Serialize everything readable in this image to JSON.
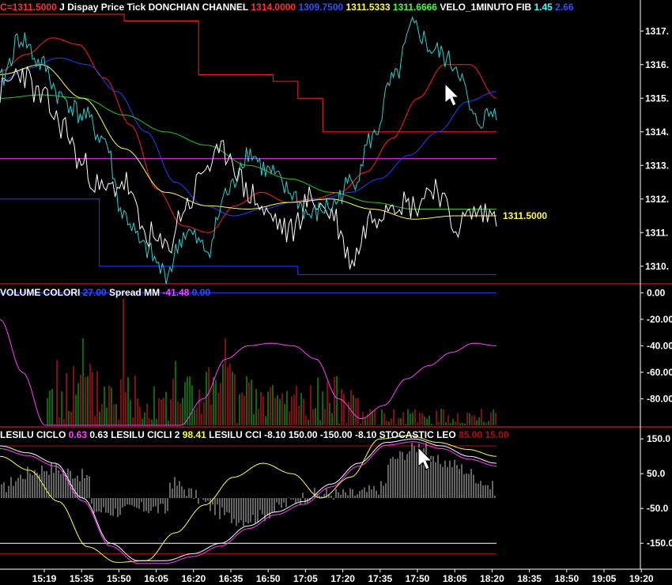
{
  "colors": {
    "bg": "#000000",
    "price": "#ffffff",
    "cyan": "#33cccc",
    "red": "#ff2020",
    "blue": "#2040ff",
    "green": "#20cc20",
    "yellow": "#ffff40",
    "magenta": "#ff40ff",
    "darkred": "#b01010"
  },
  "panels": {
    "price": {
      "header": [
        {
          "text": "C=1311.5000",
          "color": "#ff3030"
        },
        {
          "text": "J Dispay Price Tick",
          "color": "#ffffff"
        },
        {
          "text": "DONCHIAN CHANNEL",
          "color": "#ffffff"
        },
        {
          "text": "1314.0000",
          "color": "#ff3030"
        },
        {
          "text": "1309.7500",
          "color": "#3050ff"
        },
        {
          "text": "1311.5333",
          "color": "#ffff40"
        },
        {
          "text": "1311.6666",
          "color": "#40ff40"
        },
        {
          "text": "VELO_1MINUTO FIB",
          "color": "#ffffff"
        },
        {
          "text": "1.45",
          "color": "#40ffff"
        },
        {
          "text": "2.66",
          "color": "#3050ff"
        }
      ],
      "ticks": [
        "1317.",
        "1316.",
        "1315.",
        "1314.",
        "1313.",
        "1312.",
        "1311.",
        "1310."
      ],
      "last_value_label": "1311.5000"
    },
    "volume": {
      "header": [
        {
          "text": "VOLUME COLORI",
          "color": "#ffffff"
        },
        {
          "text": "27.00",
          "color": "#3050ff"
        },
        {
          "text": "Spread MM",
          "color": "#ffffff"
        },
        {
          "text": "-41.48",
          "color": "#ff40ff"
        },
        {
          "text": "0.00",
          "color": "#3050ff"
        }
      ],
      "ticks": [
        "0.00",
        "-20.00",
        "-40.00",
        "-60.00",
        "-80.00"
      ]
    },
    "osc": {
      "header": [
        {
          "text": "LESILU CICLO",
          "color": "#ffffff"
        },
        {
          "text": "0.63",
          "color": "#ff40ff"
        },
        {
          "text": "0.63",
          "color": "#ffffff"
        },
        {
          "text": "LESILU CICLI 2",
          "color": "#ffffff"
        },
        {
          "text": "98.41",
          "color": "#ffff40"
        },
        {
          "text": "LESILU CCI",
          "color": "#ffffff"
        },
        {
          "text": "-8.10",
          "color": "#ffffff"
        },
        {
          "text": "150.00",
          "color": "#ffffff"
        },
        {
          "text": "-150.00",
          "color": "#ffffff"
        },
        {
          "text": "-8.10",
          "color": "#ffffff"
        },
        {
          "text": "STOCASTIC LEO",
          "color": "#ffffff"
        },
        {
          "text": "85.00",
          "color": "#b01010"
        },
        {
          "text": "15.00",
          "color": "#b01010"
        }
      ],
      "ticks": [
        "150.0",
        "50.0",
        "-50.0",
        "-150.0"
      ]
    }
  },
  "time_axis": [
    "15:19",
    "15:35",
    "15:50",
    "16:05",
    "16:20",
    "16:35",
    "16:50",
    "17:05",
    "17:20",
    "17:35",
    "17:50",
    "18:05",
    "18:20",
    "18:35",
    "18:50",
    "19:05",
    "19:20"
  ],
  "chart_data": {
    "type": "line",
    "price_series": {
      "ylim": [
        1309.5,
        1317.5
      ],
      "donchian_upper": [
        1317.5,
        1317.5,
        1317.5,
        1317.5,
        1317.5,
        1317.3,
        1317.3,
        1317.3,
        1315.7,
        1315.7,
        1315.7,
        1315.5,
        1315.0,
        1314.0,
        1314.0,
        1314.0,
        1314.0,
        1314.0,
        1314.0,
        1314.0
      ],
      "donchian_lower": [
        1312.0,
        1312.0,
        1312.0,
        1312.0,
        1310.0,
        1310.0,
        1310.0,
        1310.0,
        1310.0,
        1310.0,
        1310.0,
        1310.0,
        1309.75,
        1309.75,
        1309.75,
        1309.75,
        1309.75,
        1309.75,
        1309.75,
        1309.75
      ],
      "horizontal_level": 1313.2,
      "close_cyan": [
        1315.5,
        1316.8,
        1316.0,
        1315.0,
        1314.5,
        1313.8,
        1311.5,
        1310.5,
        1309.8,
        1311.0,
        1310.5,
        1312.2,
        1313.4,
        1312.8,
        1312.2,
        1311.5,
        1311.8,
        1312.5,
        1313.8,
        1315.5,
        1317.1,
        1316.4,
        1316.0,
        1314.3,
        1314.6
      ],
      "white_series": [
        1315.2,
        1315.8,
        1315.0,
        1314.2,
        1313.0,
        1312.2,
        1312.5,
        1311.0,
        1310.5,
        1311.8,
        1313.0,
        1313.4,
        1312.2,
        1311.5,
        1311.0,
        1312.0,
        1311.6,
        1310.2,
        1311.5,
        1312.0,
        1311.8,
        1312.4,
        1311.2,
        1311.6,
        1311.5
      ],
      "red_ma": [
        1315.8,
        1316.3,
        1316.8,
        1316.6,
        1315.6,
        1314.2,
        1312.3,
        1311.2,
        1311.0,
        1311.8,
        1312.2,
        1311.9,
        1312.0,
        1312.2,
        1312.8,
        1313.8,
        1315.0,
        1316.0,
        1316.0,
        1315.0
      ],
      "blue_ma": [
        1315.5,
        1315.9,
        1316.2,
        1316.0,
        1315.2,
        1314.0,
        1312.5,
        1311.8,
        1311.5,
        1311.7,
        1311.9,
        1312.0,
        1312.2,
        1312.6,
        1313.3,
        1314.0,
        1314.9,
        1315.2
      ],
      "green_ma": [
        1315.0,
        1315.1,
        1315.0,
        1314.5,
        1314.0,
        1313.6,
        1313.0,
        1312.6,
        1312.2,
        1311.9,
        1311.7,
        1311.7,
        1311.7
      ],
      "yellow_ma": [
        1315.7,
        1316.0,
        1315.0,
        1313.5,
        1312.2,
        1311.8,
        1311.7,
        1311.9,
        1312.0,
        1311.7,
        1311.4,
        1311.5,
        1311.5
      ]
    },
    "volume_series": {
      "ylim": [
        -100,
        5
      ],
      "spread_mm": [
        -20,
        -60,
        -100,
        -100,
        -100,
        -100,
        -100,
        -100,
        -100,
        -80,
        -50,
        -40,
        -38,
        -40,
        -50,
        -80,
        -95,
        -85,
        -65,
        -55,
        -45,
        -38,
        -40
      ]
    },
    "osc_series": {
      "ylim": [
        -220,
        180
      ],
      "levels": [
        130,
        -150
      ],
      "stochastic_white": [
        130,
        110,
        80,
        -20,
        -150,
        -200,
        -200,
        -180,
        -150,
        -100,
        -60,
        -30,
        20,
        80,
        140,
        150,
        130,
        100,
        80
      ],
      "cycle_yellow": [
        100,
        60,
        -30,
        -160,
        -205,
        -200,
        -120,
        -40,
        40,
        80,
        50,
        -20,
        40,
        150,
        160,
        140,
        120,
        100
      ],
      "cci_histogram_range": [
        -150,
        150
      ]
    }
  }
}
